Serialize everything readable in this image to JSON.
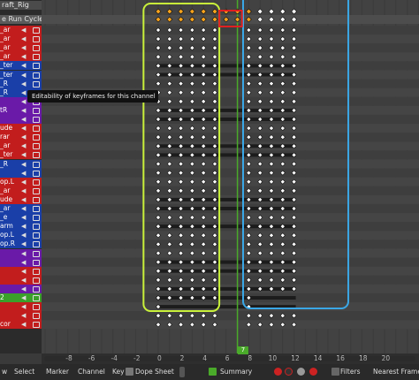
{
  "colors": {
    "bg": "#3a3a3a",
    "select_box_green": "#c9f13a",
    "select_box_blue": "#3aa7e6",
    "key_selected": "#f7a31d",
    "key_box_red": "#e02020",
    "key_white": "#ffffff",
    "current_frame_line": "#4aaa2a"
  },
  "channels": {
    "header_label": "raft_Rig",
    "action_label": "e Run Cycle N",
    "items": [
      {
        "label": "_ar",
        "color": "#c21d1d"
      },
      {
        "label": "_ar",
        "color": "#c21d1d"
      },
      {
        "label": "_ar",
        "color": "#c21d1d"
      },
      {
        "label": "_ar",
        "color": "#c21d1d"
      },
      {
        "label": "_ter",
        "color": "#1a3fa8"
      },
      {
        "label": "_ter",
        "color": "#1a3fa8"
      },
      {
        "label": "_R",
        "color": "#1a3fa8"
      },
      {
        "label": "_R",
        "color": "#1a3fa8"
      },
      {
        "label": "",
        "color": "#6a1aa8"
      },
      {
        "label": "tR",
        "color": "#6a1aa8"
      },
      {
        "label": "",
        "color": "#6a1aa8"
      },
      {
        "label": "ude",
        "color": "#c21d1d"
      },
      {
        "label": "rar",
        "color": "#c21d1d"
      },
      {
        "label": "_ar",
        "color": "#c21d1d"
      },
      {
        "label": "_ter",
        "color": "#c21d1d"
      },
      {
        "label": "_R",
        "color": "#1a3fa8"
      },
      {
        "label": "",
        "color": "#1a3fa8"
      },
      {
        "label": "op.L",
        "color": "#c21d1d"
      },
      {
        "label": "_ar",
        "color": "#c21d1d"
      },
      {
        "label": "ude",
        "color": "#c21d1d"
      },
      {
        "label": "_ar",
        "color": "#1a3fa8"
      },
      {
        "label": "_e",
        "color": "#1a3fa8"
      },
      {
        "label": "arm",
        "color": "#1a3fa8"
      },
      {
        "label": "op.L",
        "color": "#1a3fa8"
      },
      {
        "label": "op.R",
        "color": "#1a3fa8"
      },
      {
        "label": "",
        "color": "#6a1aa8"
      },
      {
        "label": "",
        "color": "#6a1aa8"
      },
      {
        "label": "",
        "color": "#c21d1d"
      },
      {
        "label": "",
        "color": "#c21d1d"
      },
      {
        "label": "",
        "color": "#6a1aa8"
      },
      {
        "label": "2",
        "color": "#3aa02a"
      },
      {
        "label": "",
        "color": "#c21d1d"
      },
      {
        "label": "",
        "color": "#c21d1d"
      },
      {
        "label": "cor",
        "color": "#c21d1d"
      }
    ]
  },
  "tooltip": {
    "text": "Editability of keyframes for this channel"
  },
  "ruler": {
    "ticks": [
      "-8",
      "-6",
      "-4",
      "-2",
      "0",
      "2",
      "4",
      "6",
      "8",
      "10",
      "12",
      "14",
      "16",
      "18",
      "20"
    ],
    "current_frame": "7"
  },
  "footer": {
    "items": {
      "view": "w",
      "select": "Select",
      "marker": "Marker",
      "channel": "Channel",
      "key": "Key",
      "mode": "Dope Sheet",
      "summary": "Summary",
      "filters": "Filters",
      "snap": "Nearest Frame"
    }
  }
}
